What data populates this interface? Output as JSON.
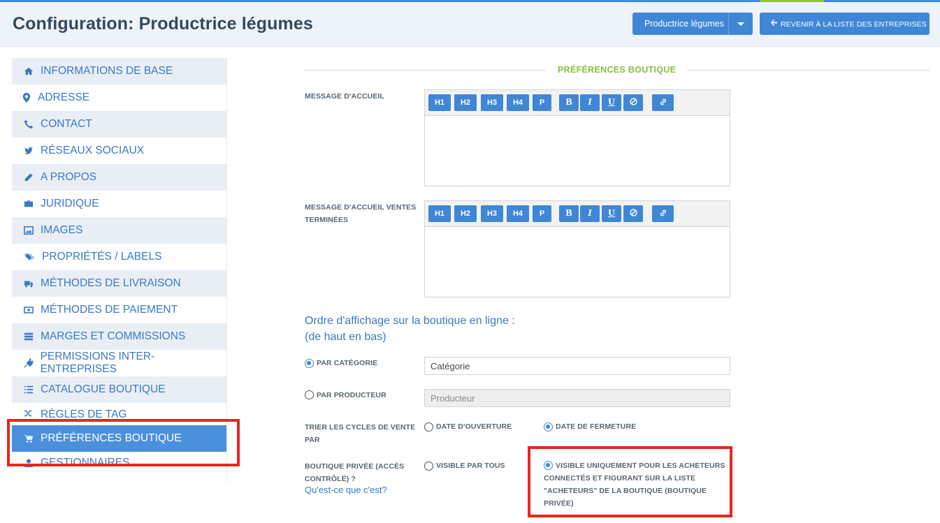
{
  "header": {
    "title": "Configuration: Productrice légumes",
    "company_select": "Productrice légumes",
    "back_button": "REVENIR À LA LISTE DES ENTREPRISES"
  },
  "sidebar": {
    "items": [
      {
        "label": "INFORMATIONS DE BASE",
        "icon": "home-icon"
      },
      {
        "label": "ADRESSE",
        "icon": "map-marker-icon"
      },
      {
        "label": "CONTACT",
        "icon": "phone-icon"
      },
      {
        "label": "RÉSEAUX SOCIAUX",
        "icon": "twitter-icon"
      },
      {
        "label": "A PROPOS",
        "icon": "pencil-icon"
      },
      {
        "label": "JURIDIQUE",
        "icon": "briefcase-icon"
      },
      {
        "label": "IMAGES",
        "icon": "picture-icon"
      },
      {
        "label": "PROPRIÉTÉS / LABELS",
        "icon": "tags-icon"
      },
      {
        "label": "MÉTHODES DE LIVRAISON",
        "icon": "truck-icon"
      },
      {
        "label": "MÉTHODES DE PAIEMENT",
        "icon": "money-icon"
      },
      {
        "label": "MARGES ET COMMISSIONS",
        "icon": "server-icon"
      },
      {
        "label": "PERMISSIONS INTER-ENTREPRISES",
        "icon": "plug-icon"
      },
      {
        "label": "CATALOGUE BOUTIQUE",
        "icon": "list-icon"
      },
      {
        "label": "RÈGLES DE TAG",
        "icon": "random-icon"
      },
      {
        "label": "PRÉFÉRENCES BOUTIQUE",
        "icon": "cart-icon",
        "active": true
      },
      {
        "label": "GESTIONNAIRES",
        "icon": "user-icon"
      }
    ]
  },
  "main": {
    "section_title": "PRÉFÉRENCES BOUTIQUE",
    "welcome_label": "MESSAGE D'ACCUEIL",
    "welcome_closed_label_line1": "MESSAGE D'ACCUEIL VENTES",
    "welcome_closed_label_line2": "TERMINÉES",
    "toolbar": {
      "h1": "H1",
      "h2": "H2",
      "h3": "H3",
      "h4": "H4",
      "p": "P",
      "bold": "B",
      "italic": "I",
      "underline": "U",
      "clear_icon": "ban-icon",
      "link_icon": "link-icon"
    },
    "order_heading_line1": "Ordre d'affichage sur la boutique en ligne :",
    "order_heading_line2": "(de haut en bas)",
    "by_category_label": "PAR CATÉGORIE",
    "by_category_value": "Catégorie",
    "by_category_checked": true,
    "by_producer_label": "PAR PRODUCTEUR",
    "by_producer_value": "Producteur",
    "by_producer_checked": false,
    "sort_label_line1": "TRIER LES CYCLES DE VENTE",
    "sort_label_line2": "PAR",
    "sort_open_label": "DATE D'OUVERTURE",
    "sort_open_checked": false,
    "sort_close_label": "DATE DE FERMETURE",
    "sort_close_checked": true,
    "private_label_line1": "BOUTIQUE PRIVÉE (ACCÈS",
    "private_label_line2": "CONTRÔLÉ) ?",
    "private_help_link": "Qu'est-ce que c'est?",
    "visible_all_label": "VISIBLE PAR TOUS",
    "visible_all_checked": false,
    "visible_buyers_line1": "VISIBLE UNIQUEMENT POUR LES ACHETEURS",
    "visible_buyers_line2": "CONNECTÉS ET FIGURANT SUR LA LISTE",
    "visible_buyers_line3": "\"ACHETEURS\" DE LA BOUTIQUE (BOUTIQUE",
    "visible_buyers_line4": "PRIVÉE)",
    "visible_buyers_checked": true
  },
  "colors": {
    "primary": "#3f87d6",
    "section_green": "#8cbf3f",
    "highlight_red": "#e8261c",
    "sidebar_shade": "#e9eef5"
  }
}
